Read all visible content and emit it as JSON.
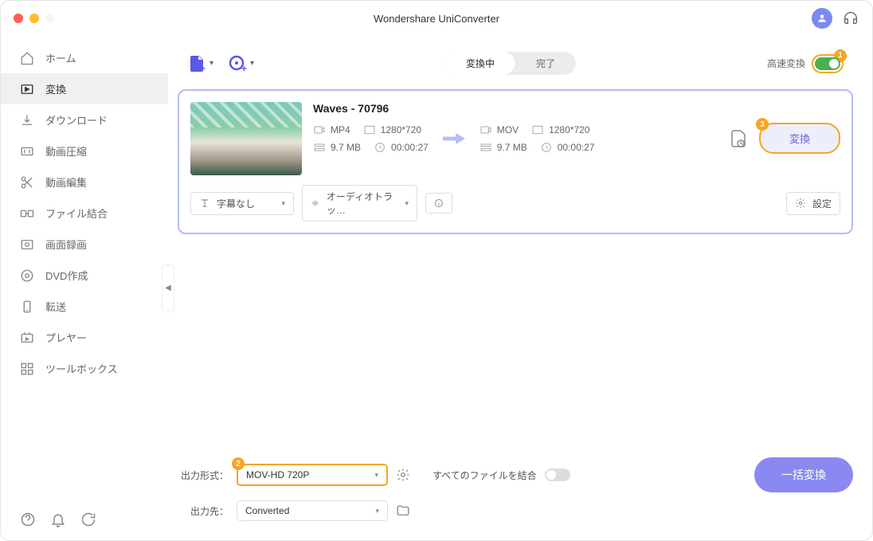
{
  "app": {
    "title": "Wondershare UniConverter"
  },
  "sidebar": {
    "items": [
      {
        "label": "ホーム"
      },
      {
        "label": "変換"
      },
      {
        "label": "ダウンロード"
      },
      {
        "label": "動画圧縮"
      },
      {
        "label": "動画編集"
      },
      {
        "label": "ファイル結合"
      },
      {
        "label": "画面録画"
      },
      {
        "label": "DVD作成"
      },
      {
        "label": "転送"
      },
      {
        "label": "プレヤー"
      },
      {
        "label": "ツールボックス"
      }
    ]
  },
  "tabs": {
    "in_progress": "変換中",
    "done": "完了"
  },
  "fast": {
    "label": "高速変換",
    "marker": "1"
  },
  "file": {
    "title": "Waves - 70796",
    "src": {
      "format": "MP4",
      "resolution": "1280*720",
      "size": "9.7 MB",
      "duration": "00:00:27"
    },
    "dst": {
      "format": "MOV",
      "resolution": "1280*720",
      "size": "9.7 MB",
      "duration": "00:00:27"
    }
  },
  "convert": {
    "label": "変換",
    "marker": "3"
  },
  "subtitle": {
    "label": "字幕なし"
  },
  "audio": {
    "label": "オーディオトラッ…"
  },
  "settings_btn": "設定",
  "bottom": {
    "format_label": "出力形式：",
    "format_value": "MOV-HD 720P",
    "format_marker": "2",
    "output_label": "出力先：",
    "output_value": "Converted",
    "merge_label": "すべてのファイルを結合",
    "batch": "一括変換"
  }
}
